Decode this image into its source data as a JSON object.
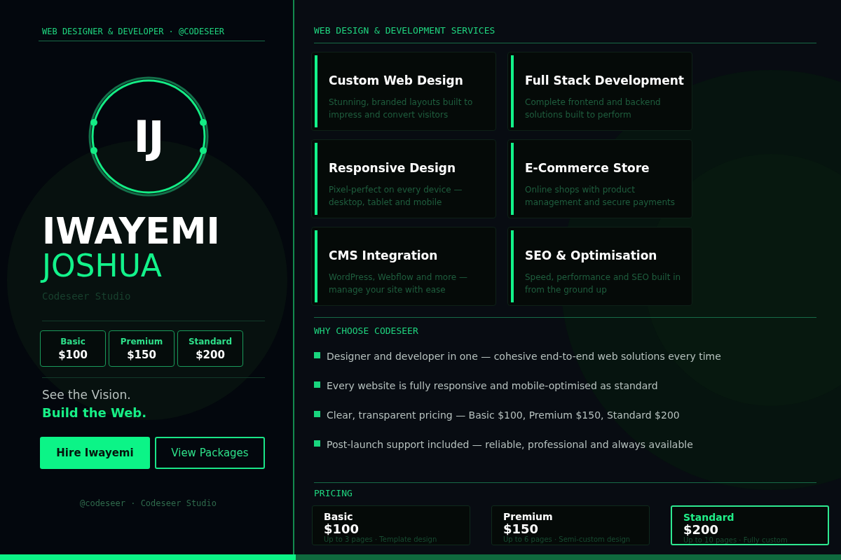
{
  "profile": {
    "tagline": "WEB DESIGNER & DEVELOPER · @CODESEER",
    "initials": "IJ",
    "first_name": "IWAYEMI",
    "last_name": "JOSHUA",
    "studio": "Codeseer Studio",
    "prices": [
      {
        "name": "Basic",
        "price": "$100"
      },
      {
        "name": "Premium",
        "price": "$150"
      },
      {
        "name": "Standard",
        "price": "$200"
      }
    ],
    "slogan_1": "See the Vision.",
    "slogan_2": "Build the Web.",
    "buttons": [
      {
        "label": "Hire Iwayemi",
        "kind": "primary"
      },
      {
        "label": "View Packages",
        "kind": "outline"
      }
    ],
    "footer": "@codeseer · Codeseer Studio"
  },
  "services": {
    "heading": "WEB DESIGN & DEVELOPMENT SERVICES",
    "items": [
      {
        "title": "Custom Web Design",
        "description": "Stunning, branded layouts built to impress and convert visitors"
      },
      {
        "title": "Full Stack Development",
        "description": "Complete frontend and backend solutions built to perform"
      },
      {
        "title": "Responsive Design",
        "description": "Pixel-perfect on every device — desktop, tablet and mobile"
      },
      {
        "title": "E-Commerce Store",
        "description": "Online shops with product management and secure payments"
      },
      {
        "title": "CMS Integration",
        "description": "WordPress, Webflow and more — manage your site with ease"
      },
      {
        "title": "SEO & Optimisation",
        "description": "Speed, performance and SEO built in from the ground up"
      }
    ]
  },
  "why": {
    "heading": "WHY CHOOSE CODESEER",
    "points": [
      "Designer and developer in one — cohesive end-to-end web solutions every time",
      "Every website is fully responsive and mobile-optimised as standard",
      "Clear, transparent pricing — Basic $100, Premium $150, Standard $200",
      "Post-launch support included — reliable, professional and always available"
    ]
  },
  "pricing": {
    "heading": "PRICING",
    "plans": [
      {
        "name": "Basic",
        "price": "$100",
        "note": "Up to 3 pages · Template design",
        "selected": false
      },
      {
        "name": "Premium",
        "price": "$150",
        "note": "Up to 6 pages · Semi-custom design",
        "selected": false
      },
      {
        "name": "Standard",
        "price": "$200",
        "note": "Up to 10 pages · Fully custom",
        "selected": true
      }
    ]
  }
}
